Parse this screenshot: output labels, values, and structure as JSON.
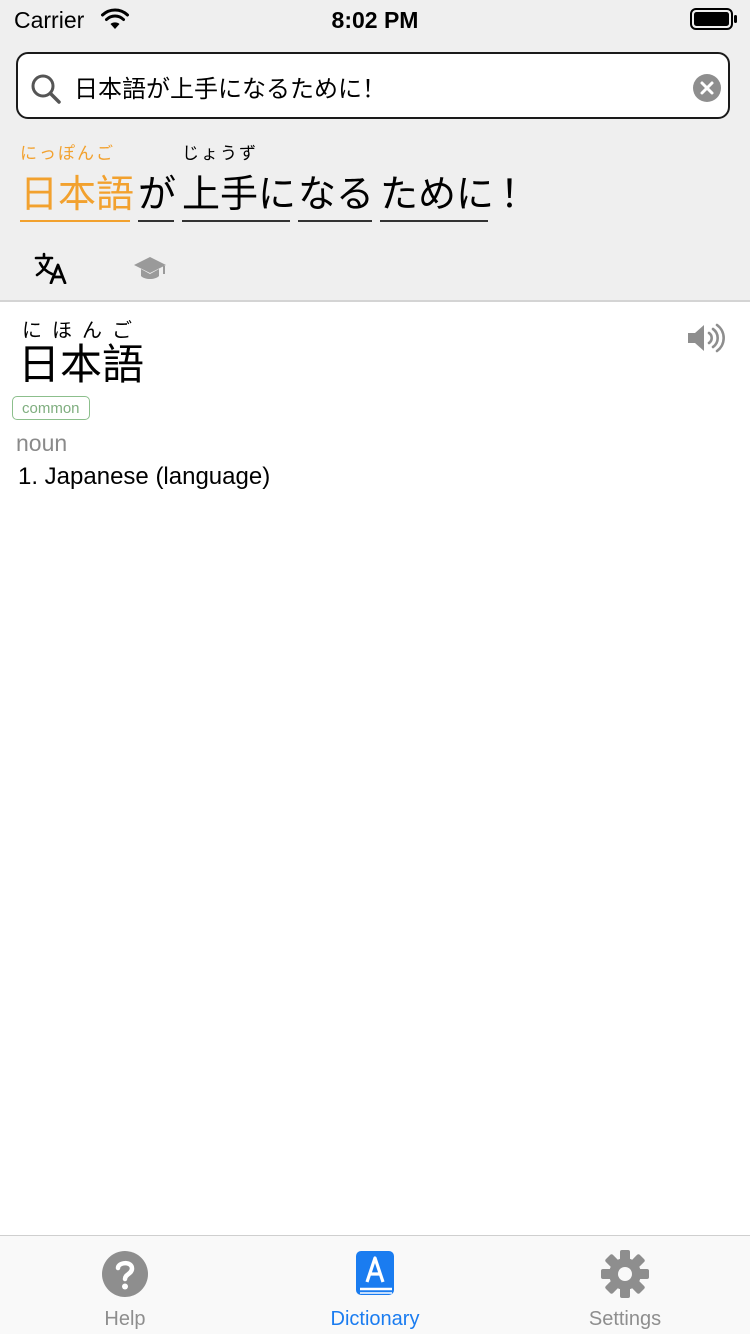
{
  "status_bar": {
    "carrier": "Carrier",
    "time": "8:02 PM"
  },
  "search": {
    "value": "日本語が上手になるために！"
  },
  "sentence": {
    "tokens": [
      {
        "text": "日本語",
        "furigana": "にっぽんご",
        "active": true
      },
      {
        "text": "が",
        "furigana": "",
        "active": false
      },
      {
        "text": "上手に",
        "furigana": "じょうず",
        "active": false
      },
      {
        "text": "なる",
        "furigana": "",
        "active": false
      },
      {
        "text": "ために",
        "furigana": "",
        "active": false
      },
      {
        "text": "！",
        "furigana": "",
        "active": false
      }
    ]
  },
  "entry": {
    "reading": "にほんご",
    "word": "日本語",
    "badge": "common",
    "part_of_speech": "noun",
    "definition": "1. Japanese (language)"
  },
  "tabs": [
    {
      "label": "Help",
      "icon": "help-icon",
      "selected": false
    },
    {
      "label": "Dictionary",
      "icon": "dictionary-icon",
      "selected": true
    },
    {
      "label": "Settings",
      "icon": "gear-icon",
      "selected": false
    }
  ],
  "colors": {
    "accent_orange": "#f2a12e",
    "tab_selected": "#1a7cf0",
    "badge_green": "#8cbf8c"
  }
}
